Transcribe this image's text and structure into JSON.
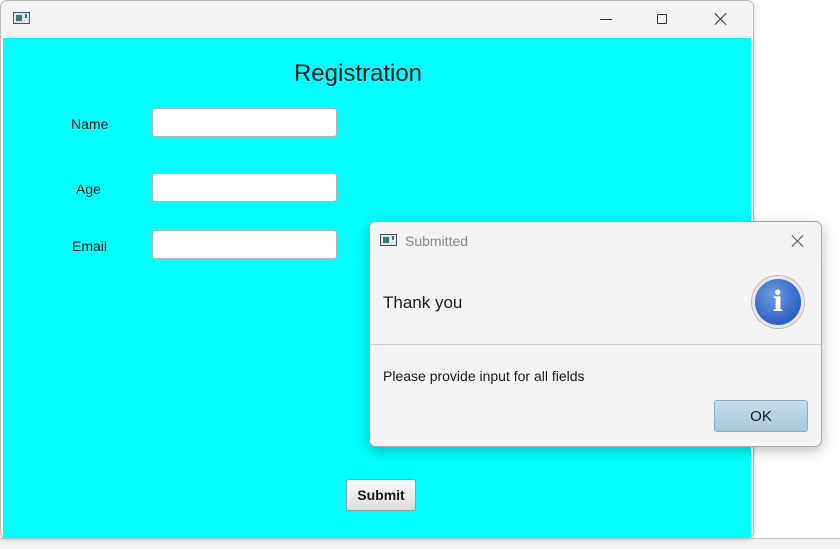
{
  "main_window": {
    "icon": "java-app-icon",
    "controls": {
      "minimize_icon": "minimize-icon",
      "maximize_icon": "maximize-icon",
      "close_icon": "close-icon"
    },
    "background_color": "#00ffff",
    "form": {
      "title": "Registration",
      "fields": [
        {
          "label": "Name",
          "value": "",
          "placeholder": ""
        },
        {
          "label": "Age",
          "value": "",
          "placeholder": ""
        },
        {
          "label": "Email",
          "value": "",
          "placeholder": ""
        }
      ],
      "submit_label": "Submit"
    }
  },
  "dialog": {
    "icon": "java-app-icon",
    "title": "Submitted",
    "close_icon": "close-icon",
    "header_text": "Thank you",
    "header_icon": "info-icon",
    "info_glyph": "i",
    "info_color": "#2d61c4",
    "message": "Please provide input for all fields",
    "ok_label": "OK"
  }
}
